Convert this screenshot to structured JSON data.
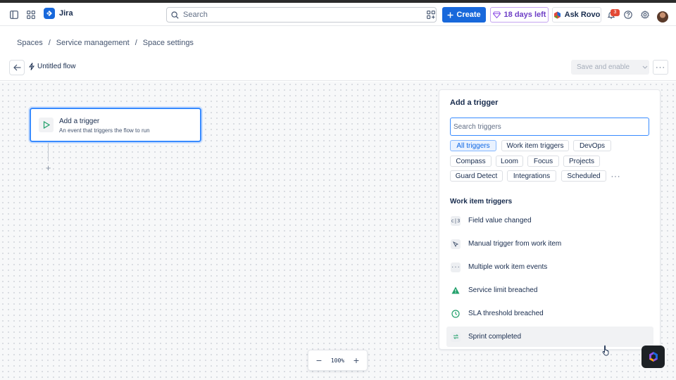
{
  "header": {
    "app_name": "Jira",
    "search_placeholder": "Search",
    "create_label": "Create",
    "trial_label": "18 days left",
    "ask_rovo_label": "Ask Rovo",
    "notification_count": "3"
  },
  "breadcrumb": {
    "items": [
      "Spaces",
      "Service management",
      "Space settings"
    ]
  },
  "flow": {
    "title": "Untitled flow",
    "save_label": "Save and enable"
  },
  "node": {
    "title": "Add a trigger",
    "description": "An event that triggers the flow to run"
  },
  "panel": {
    "title": "Add a trigger",
    "search_placeholder": "Search triggers",
    "chips": [
      "All triggers",
      "Work item triggers",
      "DevOps",
      "Compass",
      "Loom",
      "Focus",
      "Projects",
      "Guard Detect",
      "Integrations",
      "Scheduled"
    ],
    "section_title": "Work item triggers",
    "items": [
      {
        "label": "Field value changed",
        "icon": "field-icon"
      },
      {
        "label": "Manual trigger from work item",
        "icon": "manual-icon"
      },
      {
        "label": "Multiple work item events",
        "icon": "ellipsis-icon"
      },
      {
        "label": "Service limit breached",
        "icon": "warning-icon"
      },
      {
        "label": "SLA threshold breached",
        "icon": "clock-icon"
      },
      {
        "label": "Sprint completed",
        "icon": "sprint-icon"
      }
    ]
  },
  "zoom": {
    "value": "100%"
  },
  "colors": {
    "brand": "#1868db",
    "accent_border": "#388bff",
    "trial": "#6e3fc6",
    "badge": "#e34935"
  }
}
